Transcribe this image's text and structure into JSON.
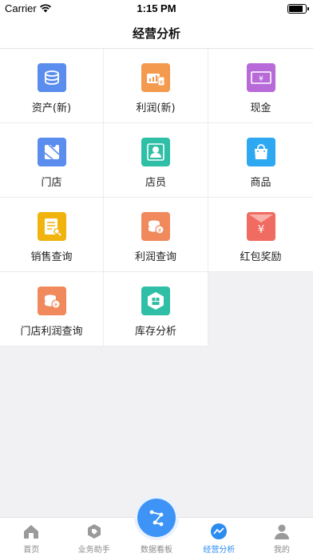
{
  "status": {
    "carrier": "Carrier",
    "time": "1:15 PM",
    "battery_level": 0.95
  },
  "header": {
    "title": "经营分析"
  },
  "grid": [
    {
      "label": "资产(新)",
      "icon": "coins-icon",
      "color": "#5b8def"
    },
    {
      "label": "利润(新)",
      "icon": "profit-chart-icon",
      "color": "#f39a4e"
    },
    {
      "label": "现金",
      "icon": "cash-icon",
      "color": "#b86bd8"
    },
    {
      "label": "门店",
      "icon": "store-map-icon",
      "color": "#5b8def"
    },
    {
      "label": "店员",
      "icon": "clerk-icon",
      "color": "#2fbfa6"
    },
    {
      "label": "商品",
      "icon": "shopping-bag-icon",
      "color": "#2fa8f2"
    },
    {
      "label": "销售查询",
      "icon": "sales-doc-icon",
      "color": "#f1b40f"
    },
    {
      "label": "利润查询",
      "icon": "yen-coins-icon",
      "color": "#f08a5d"
    },
    {
      "label": "红包奖励",
      "icon": "red-envelope-icon",
      "color": "#f06b62"
    },
    {
      "label": "门店利润查询",
      "icon": "store-yen-coins-icon",
      "color": "#f08a5d"
    },
    {
      "label": "库存分析",
      "icon": "inventory-icon",
      "color": "#2fbfa6"
    }
  ],
  "tabbar": [
    {
      "label": "首页",
      "icon": "home-icon"
    },
    {
      "label": "业务助手",
      "icon": "tag-icon"
    },
    {
      "label": "数据看板",
      "icon": "dashboard-flow-icon"
    },
    {
      "label": "经营分析",
      "icon": "analysis-icon",
      "active": true
    },
    {
      "label": "我的",
      "icon": "user-icon"
    }
  ],
  "colors": {
    "accent": "#2b8cf0",
    "background": "#f1f1f3"
  }
}
